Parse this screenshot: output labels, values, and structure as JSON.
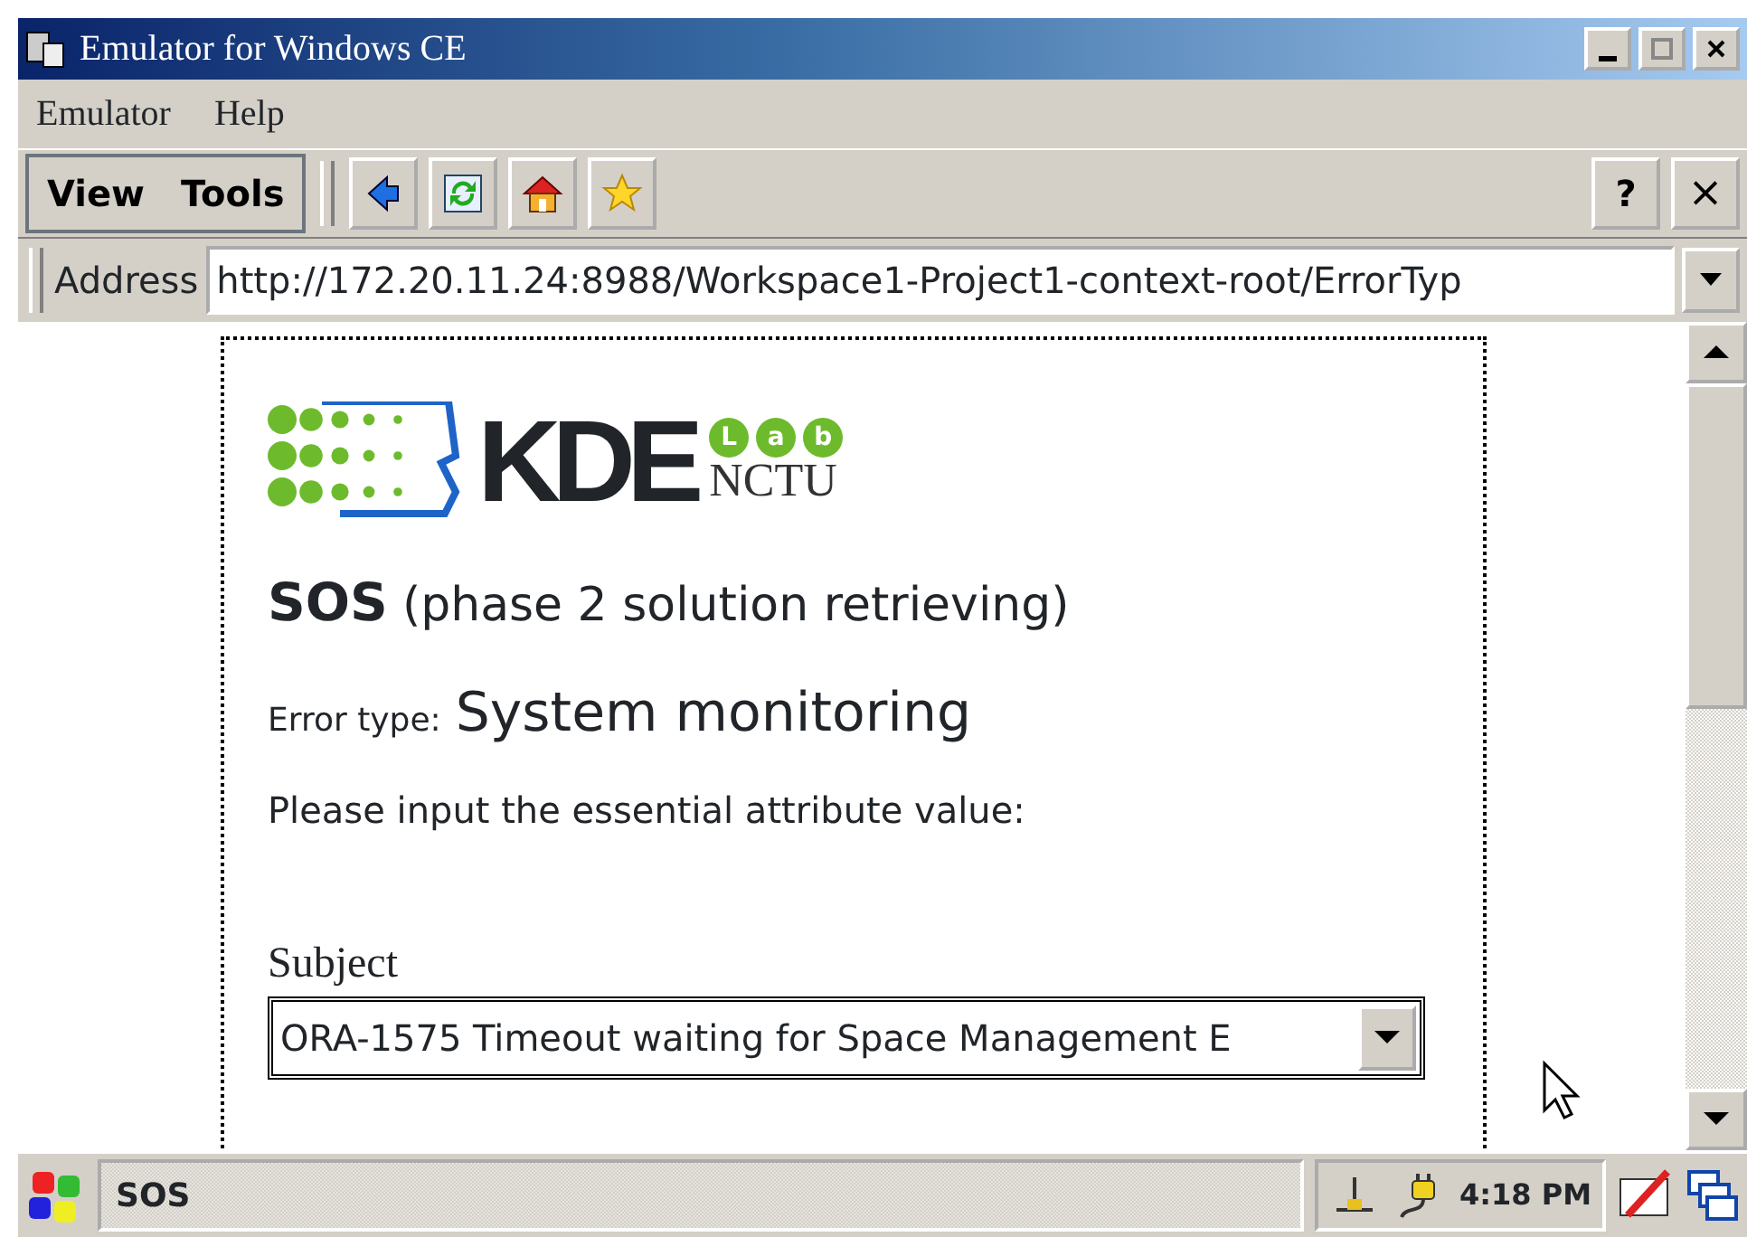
{
  "window": {
    "title": "Emulator for Windows CE"
  },
  "menu": [
    "Emulator",
    "Help"
  ],
  "toolbar": {
    "menus": [
      "View",
      "Tools"
    ],
    "help": "?",
    "close": "×"
  },
  "address": {
    "label": "Address",
    "url": "http://172.20.11.24:8988/Workspace1-Project1-context-root/ErrorTyp"
  },
  "page": {
    "logo": {
      "main": "KDE",
      "badge": [
        "L",
        "a",
        "b"
      ],
      "sub": "NCTU"
    },
    "heading": {
      "title": "SOS",
      "subtitle": "(phase 2 solution retrieving)"
    },
    "error_type": {
      "label": "Error type:",
      "value": "System monitoring"
    },
    "prompt": "Please input the essential attribute value:",
    "subject": {
      "label": "Subject",
      "value": "ORA-1575 Timeout waiting for Space Management E"
    }
  },
  "taskbar": {
    "task": "SOS",
    "clock": "4:18 PM"
  }
}
